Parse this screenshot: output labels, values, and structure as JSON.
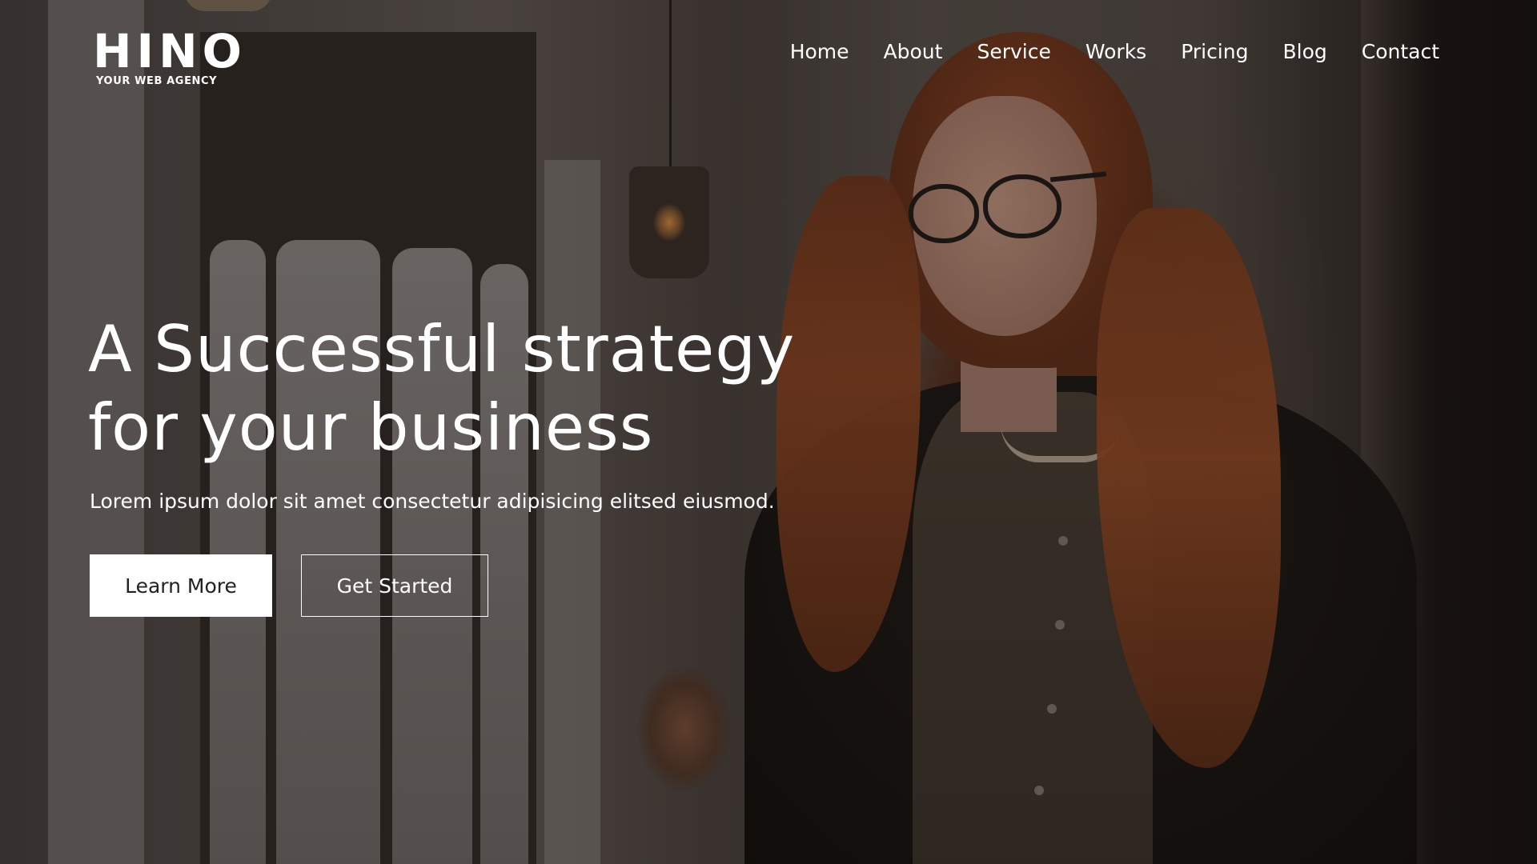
{
  "header": {
    "logo": {
      "name": "HINO",
      "tagline": "YOUR WEB AGENCY"
    },
    "nav": [
      {
        "label": "Home"
      },
      {
        "label": "About"
      },
      {
        "label": "Service"
      },
      {
        "label": "Works"
      },
      {
        "label": "Pricing"
      },
      {
        "label": "Blog"
      },
      {
        "label": "Contact"
      }
    ]
  },
  "hero": {
    "headline_line1": "A Successful strategy",
    "headline_line2": "for your business",
    "subtext": "Lorem ipsum dolor sit amet consectetur adipisicing elitsed eiusmod.",
    "primary_button": "Learn More",
    "secondary_button": "Get Started"
  },
  "colors": {
    "text": "#ffffff",
    "primary_button_bg": "#ffffff",
    "primary_button_text": "#222222"
  }
}
